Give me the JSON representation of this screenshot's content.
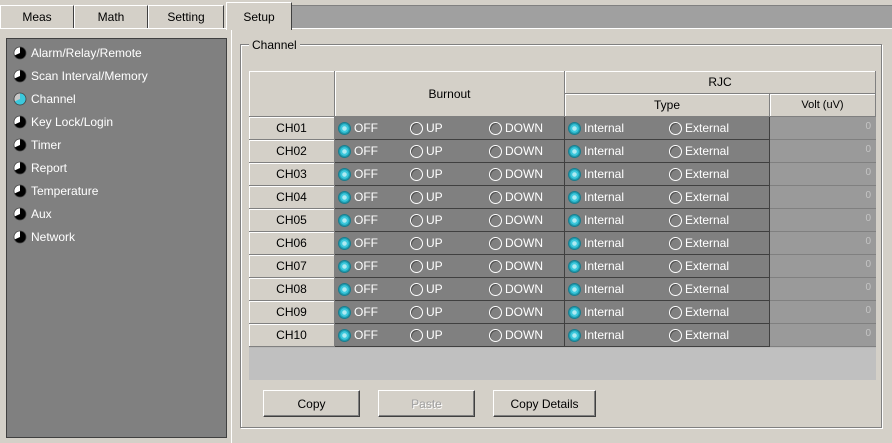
{
  "tabs": [
    {
      "label": "Meas",
      "active": false
    },
    {
      "label": "Math",
      "active": false
    },
    {
      "label": "Setting",
      "active": false
    },
    {
      "label": "Setup",
      "active": true
    }
  ],
  "sidebar": {
    "items": [
      {
        "label": "Alarm/Relay/Remote",
        "selected": false
      },
      {
        "label": "Scan Interval/Memory",
        "selected": false
      },
      {
        "label": "Channel",
        "selected": true
      },
      {
        "label": "Key Lock/Login",
        "selected": false
      },
      {
        "label": "Timer",
        "selected": false
      },
      {
        "label": "Report",
        "selected": false
      },
      {
        "label": "Temperature",
        "selected": false
      },
      {
        "label": "Aux",
        "selected": false
      },
      {
        "label": "Network",
        "selected": false
      }
    ]
  },
  "group_title": "Channel",
  "grid": {
    "headers": {
      "burnout": "Burnout",
      "rjc": "RJC",
      "type": "Type",
      "volt": "Volt (uV)"
    },
    "burnout_options": [
      "OFF",
      "UP",
      "DOWN"
    ],
    "type_options": [
      "Internal",
      "External"
    ],
    "rows": [
      {
        "channel": "CH01",
        "burnout": "OFF",
        "type": "Internal",
        "volt": "0"
      },
      {
        "channel": "CH02",
        "burnout": "OFF",
        "type": "Internal",
        "volt": "0"
      },
      {
        "channel": "CH03",
        "burnout": "OFF",
        "type": "Internal",
        "volt": "0"
      },
      {
        "channel": "CH04",
        "burnout": "OFF",
        "type": "Internal",
        "volt": "0"
      },
      {
        "channel": "CH05",
        "burnout": "OFF",
        "type": "Internal",
        "volt": "0"
      },
      {
        "channel": "CH06",
        "burnout": "OFF",
        "type": "Internal",
        "volt": "0"
      },
      {
        "channel": "CH07",
        "burnout": "OFF",
        "type": "Internal",
        "volt": "0"
      },
      {
        "channel": "CH08",
        "burnout": "OFF",
        "type": "Internal",
        "volt": "0"
      },
      {
        "channel": "CH09",
        "burnout": "OFF",
        "type": "Internal",
        "volt": "0"
      },
      {
        "channel": "CH10",
        "burnout": "OFF",
        "type": "Internal",
        "volt": "0"
      }
    ]
  },
  "buttons": {
    "copy": "Copy",
    "paste": "Paste",
    "copy_details": "Copy Details"
  },
  "colors": {
    "radio_selected": "#3cc8dc",
    "nav_background": "#808080"
  }
}
